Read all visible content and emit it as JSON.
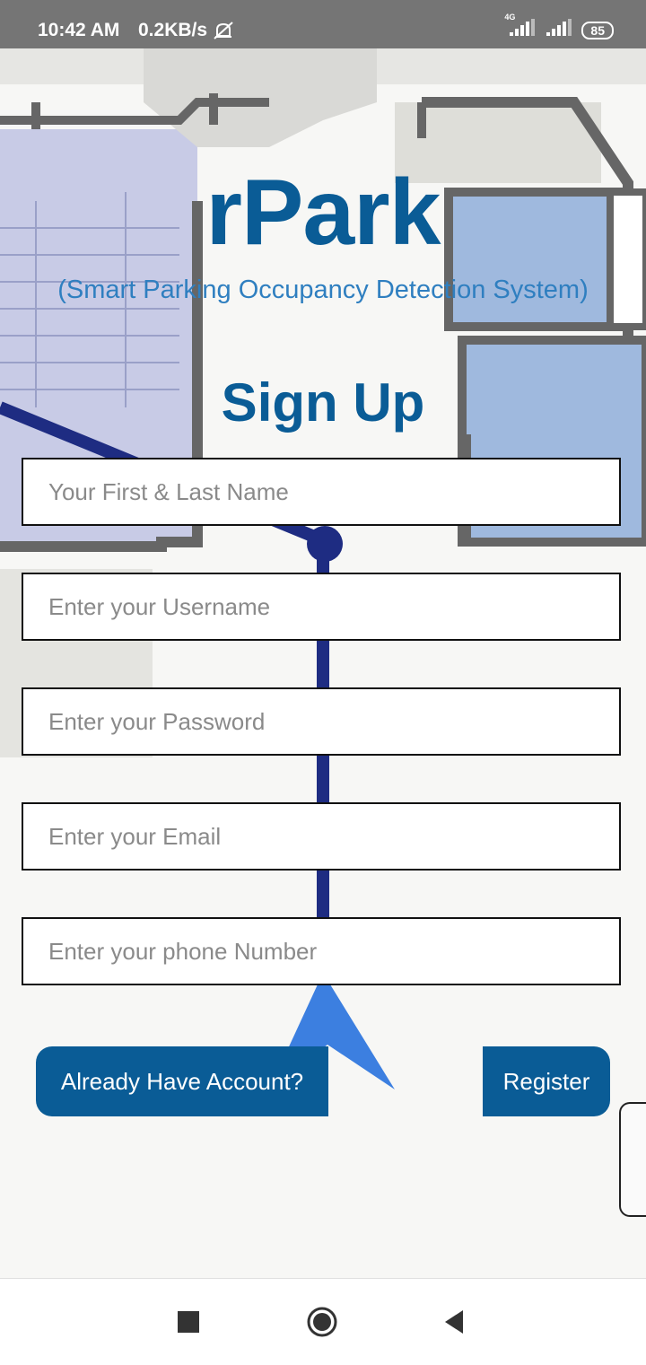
{
  "status_bar": {
    "time": "10:42 AM",
    "speed": "0.2KB/s",
    "network_label": "4G",
    "battery": "85"
  },
  "app": {
    "title": "rPark",
    "subtitle": "(Smart Parking Occupancy Detection System)",
    "heading": "Sign Up"
  },
  "form": {
    "name_placeholder": "Your First & Last Name",
    "username_placeholder": "Enter your Username",
    "password_placeholder": "Enter your Password",
    "email_placeholder": "Enter your Email",
    "phone_placeholder": "Enter your phone Number"
  },
  "buttons": {
    "login": "Already Have Account?",
    "register": "Register"
  },
  "colors": {
    "brand": "#0a5c96",
    "subtitle": "#2f7fc0",
    "status_bar": "#757575"
  },
  "icons": [
    "mute-icon",
    "signal-icon",
    "battery-icon",
    "recent-apps-icon",
    "home-icon",
    "back-icon"
  ]
}
